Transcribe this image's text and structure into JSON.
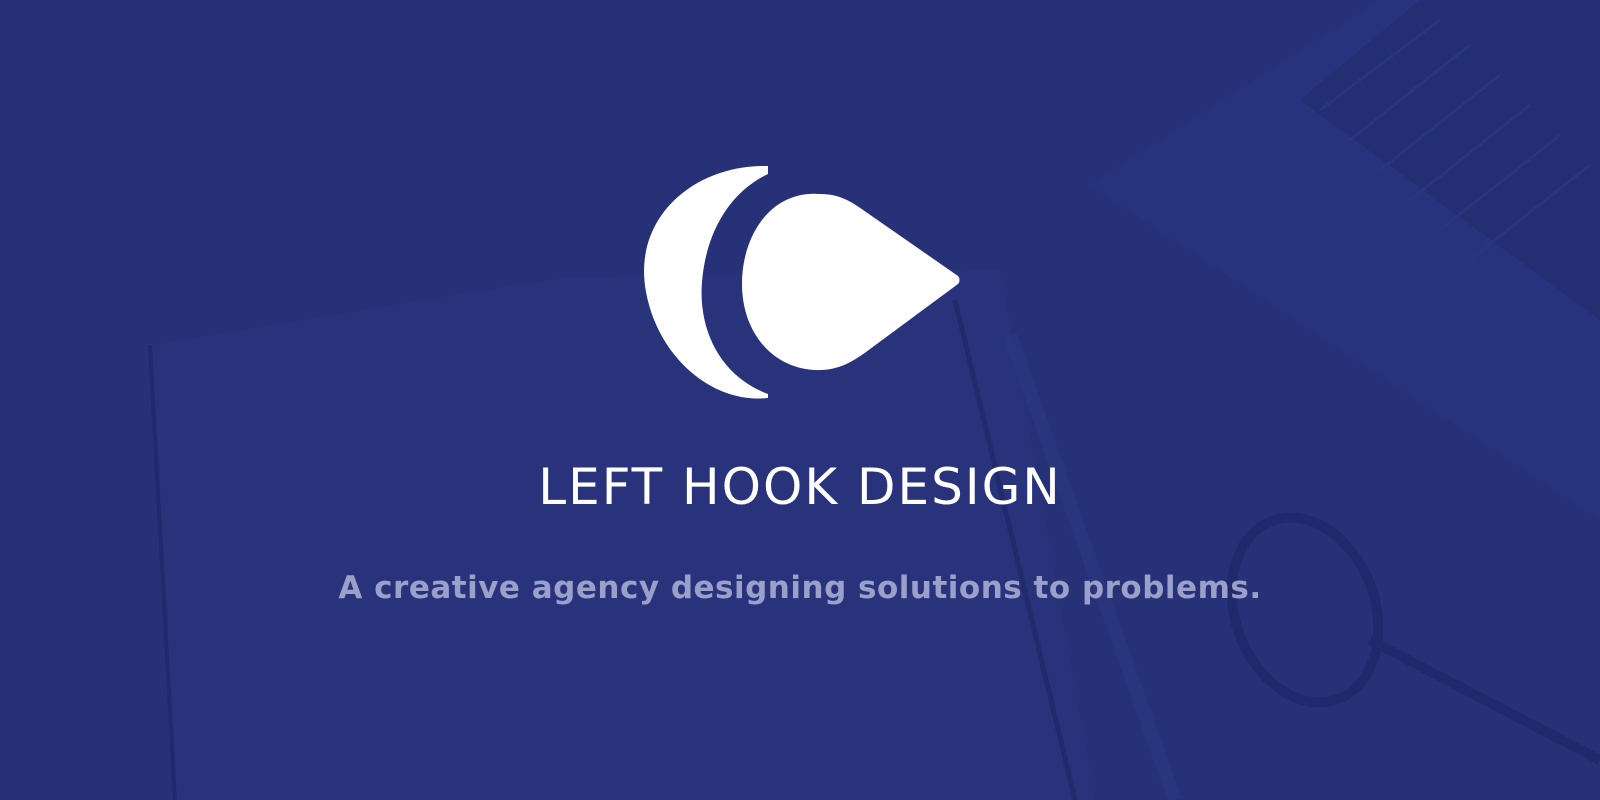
{
  "brand": {
    "name": "LEFT HOOK DESIGN",
    "tagline": "A creative agency designing solutions to problems."
  },
  "colors": {
    "background": "#263177",
    "title": "#ffffff",
    "tagline": "#9aa0c9",
    "logo": "#ffffff"
  },
  "icons": {
    "logo": "left-hook-logo",
    "background": "desk-photo-overlay"
  }
}
